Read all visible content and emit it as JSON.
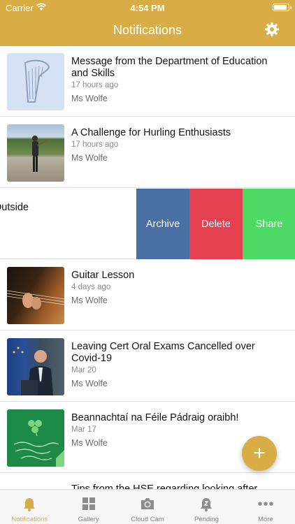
{
  "status_bar": {
    "carrier": "Carrier",
    "time": "4:54 PM"
  },
  "header": {
    "title": "Notifications"
  },
  "notifications": [
    {
      "headline": "Message from the Department of Education and Skills",
      "time": "17 hours ago",
      "author": "Ms Wolfe"
    },
    {
      "headline": "A Challenge for Hurling Enthusiasts",
      "time": "17 hours ago",
      "author": "Ms Wolfe"
    },
    {
      "headline": "Outside"
    },
    {
      "headline": "Guitar Lesson",
      "time": "4 days ago",
      "author": "Ms Wolfe"
    },
    {
      "headline": "Leaving Cert Oral Exams Cancelled over Covid-19",
      "time": "Mar 20",
      "author": "Ms Wolfe"
    },
    {
      "headline": "Beannachtaí na Féile Pádraig oraibh!",
      "time": "Mar 17",
      "author": "Ms Wolfe"
    },
    {
      "headline": "Tips from the HSE regarding looking after"
    }
  ],
  "swipe_actions": {
    "archive": "Archive",
    "delete": "Delete",
    "share": "Share"
  },
  "fab": {
    "label": "+"
  },
  "tabs": [
    {
      "label": "Notifications",
      "icon": "bell-icon",
      "active": true
    },
    {
      "label": "Gallery",
      "icon": "gallery-icon"
    },
    {
      "label": "Cloud Cam",
      "icon": "camera-icon"
    },
    {
      "label": "Pending",
      "icon": "pending-icon"
    },
    {
      "label": "More",
      "icon": "more-icon"
    }
  ],
  "colors": {
    "accent": "#d9ad45",
    "archive": "#4a6fa5",
    "delete": "#e5404f",
    "share": "#4cd964"
  }
}
